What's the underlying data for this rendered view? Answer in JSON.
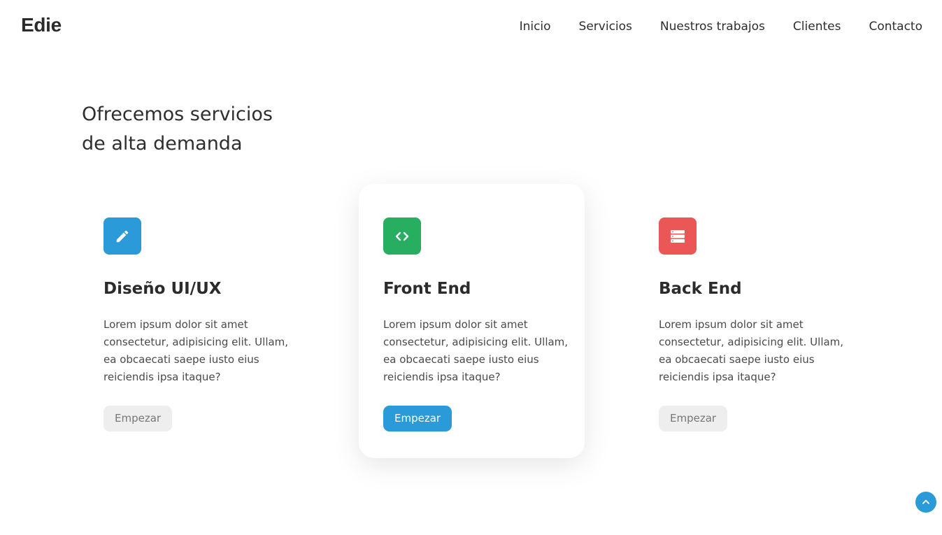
{
  "header": {
    "logo": "Edie",
    "nav": [
      "Inicio",
      "Servicios",
      "Nuestros trabajos",
      "Clientes",
      "Contacto"
    ]
  },
  "services": {
    "title_line1": "Ofrecemos servicios",
    "title_line2": "de alta demanda",
    "cards": [
      {
        "icon": "pencil-icon",
        "icon_color": "#2a9ad8",
        "title": "Diseño UI/UX",
        "text": "Lorem ipsum dolor sit amet consectetur, adipisicing elit. Ullam, ea obcaecati saepe iusto eius reiciendis ipsa itaque?",
        "button": "Empezar",
        "active": false
      },
      {
        "icon": "code-icon",
        "icon_color": "#27ae60",
        "title": "Front End",
        "text": "Lorem ipsum dolor sit amet consectetur, adipisicing elit. Ullam, ea obcaecati saepe iusto eius reiciendis ipsa itaque?",
        "button": "Empezar",
        "active": true
      },
      {
        "icon": "server-icon",
        "icon_color": "#eb5757",
        "title": "Back End",
        "text": "Lorem ipsum dolor sit amet consectetur, adipisicing elit. Ullam, ea obcaecati saepe iusto eius reiciendis ipsa itaque?",
        "button": "Empezar",
        "active": false
      }
    ]
  },
  "colors": {
    "accent": "#2a9ad8",
    "button_inactive_bg": "#eeeeee",
    "button_inactive_text": "#777777"
  },
  "scroll_top": {
    "icon": "chevron-up-icon"
  }
}
